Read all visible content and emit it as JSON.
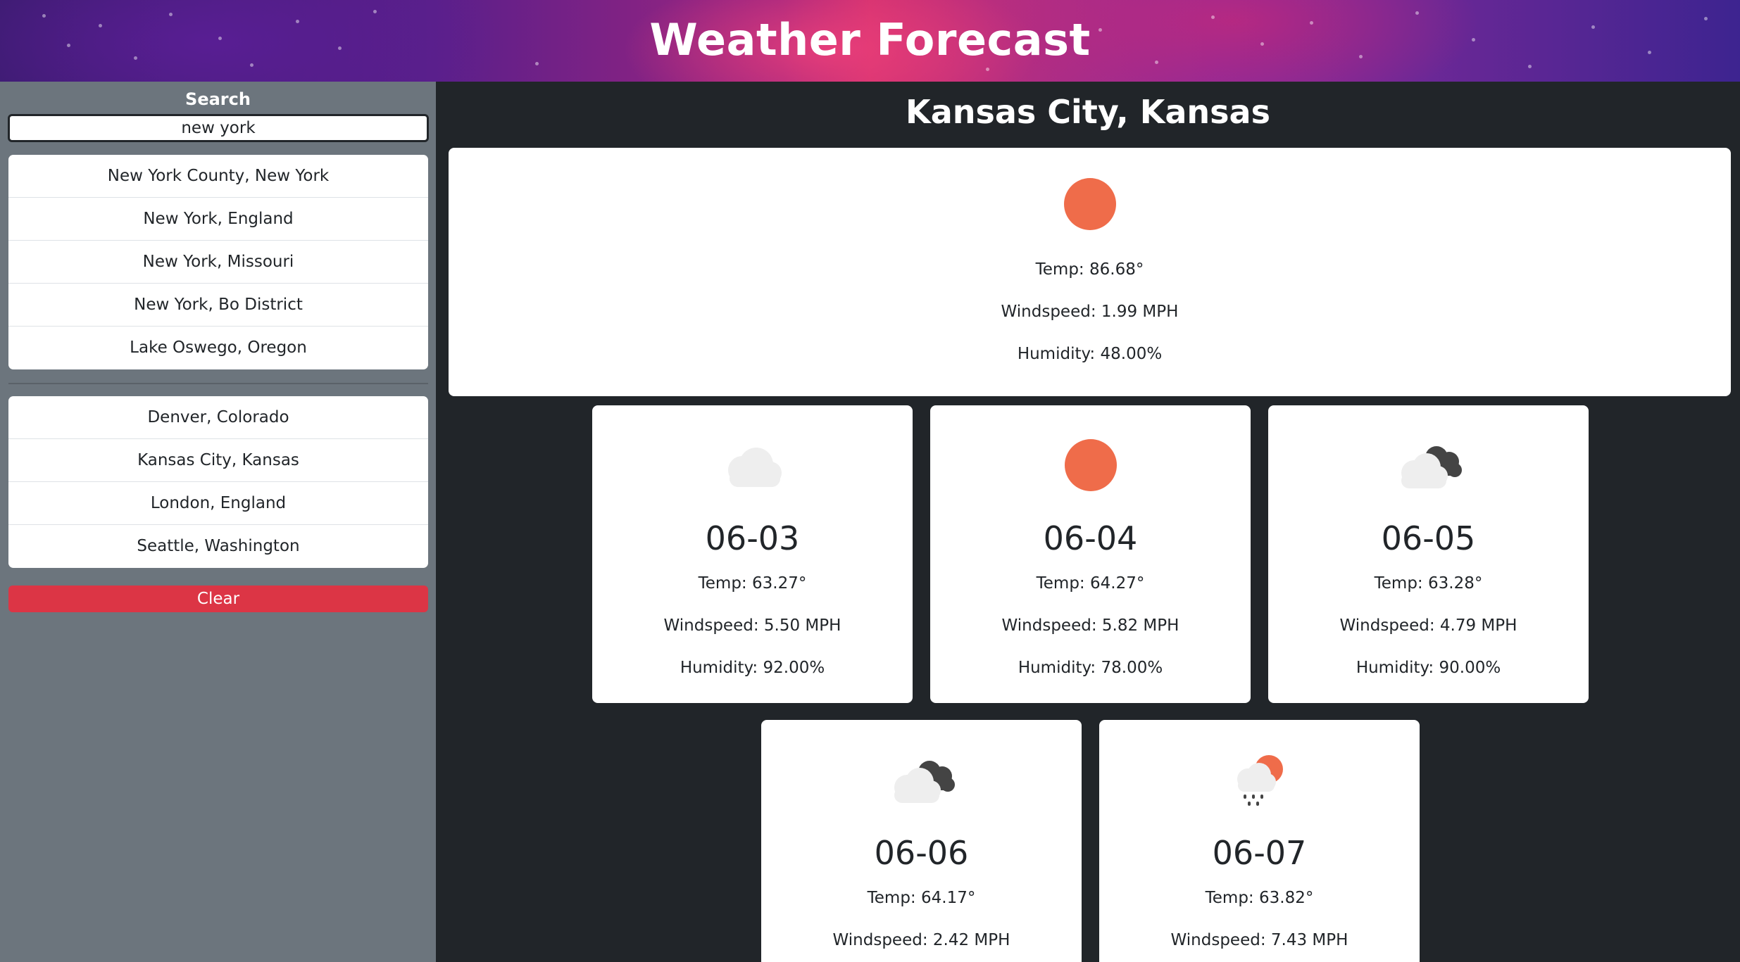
{
  "header": {
    "title": "Weather Forecast"
  },
  "sidebar": {
    "search_label": "Search",
    "search_value": "new york",
    "results": [
      "New York County, New York",
      "New York, England",
      "New York, Missouri",
      "New York, Bo District",
      "Lake Oswego, Oregon"
    ],
    "history": [
      "Denver, Colorado",
      "Kansas City, Kansas",
      "London, England",
      "Seattle, Washington"
    ],
    "clear_label": "Clear"
  },
  "main": {
    "city": "Kansas City, Kansas",
    "current": {
      "icon": "sun-icon",
      "temp": "Temp: 86.68°",
      "wind": "Windspeed: 1.99 MPH",
      "humidity": "Humidity: 48.00%"
    },
    "forecast": [
      {
        "date": "06-03",
        "icon": "cloud-icon",
        "temp": "Temp: 63.27°",
        "wind": "Windspeed: 5.50 MPH",
        "humidity": "Humidity: 92.00%"
      },
      {
        "date": "06-04",
        "icon": "sun-icon",
        "temp": "Temp: 64.27°",
        "wind": "Windspeed: 5.82 MPH",
        "humidity": "Humidity: 78.00%"
      },
      {
        "date": "06-05",
        "icon": "broken-clouds-icon",
        "temp": "Temp: 63.28°",
        "wind": "Windspeed: 4.79 MPH",
        "humidity": "Humidity: 90.00%"
      },
      {
        "date": "06-06",
        "icon": "broken-clouds-icon",
        "temp": "Temp: 64.17°",
        "wind": "Windspeed: 2.42 MPH",
        "humidity": ""
      },
      {
        "date": "06-07",
        "icon": "rain-sun-icon",
        "temp": "Temp: 63.82°",
        "wind": "Windspeed: 7.43 MPH",
        "humidity": ""
      }
    ]
  },
  "colors": {
    "accent_sun": "#ef6c4a",
    "clear_button": "#dc3545",
    "sidebar_bg": "#6c757d",
    "main_bg": "#212529"
  }
}
